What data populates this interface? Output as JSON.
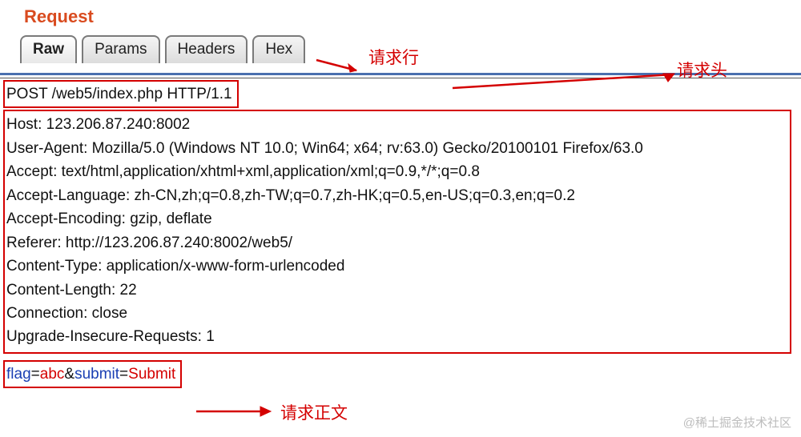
{
  "title": "Request",
  "tabs": [
    {
      "label": "Raw",
      "active": true
    },
    {
      "label": "Params",
      "active": false
    },
    {
      "label": "Headers",
      "active": false
    },
    {
      "label": "Hex",
      "active": false
    }
  ],
  "request_line": "POST /web5/index.php HTTP/1.1",
  "headers": [
    "Host: 123.206.87.240:8002",
    "User-Agent: Mozilla/5.0 (Windows NT 10.0; Win64; x64; rv:63.0) Gecko/20100101 Firefox/63.0",
    "Accept: text/html,application/xhtml+xml,application/xml;q=0.9,*/*;q=0.8",
    "Accept-Language: zh-CN,zh;q=0.8,zh-TW;q=0.7,zh-HK;q=0.5,en-US;q=0.3,en;q=0.2",
    "Accept-Encoding: gzip, deflate",
    "Referer: http://123.206.87.240:8002/web5/",
    "Content-Type: application/x-www-form-urlencoded",
    "Content-Length: 22",
    "Connection: close",
    "Upgrade-Insecure-Requests: 1"
  ],
  "body": {
    "params": [
      {
        "key": "flag",
        "value": "abc"
      },
      {
        "key": "submit",
        "value": "Submit"
      }
    ]
  },
  "annotations": {
    "request_line_label": "请求行",
    "request_headers_label": "请求头",
    "request_body_label": "请求正文"
  },
  "watermark": "@稀土掘金技术社区"
}
